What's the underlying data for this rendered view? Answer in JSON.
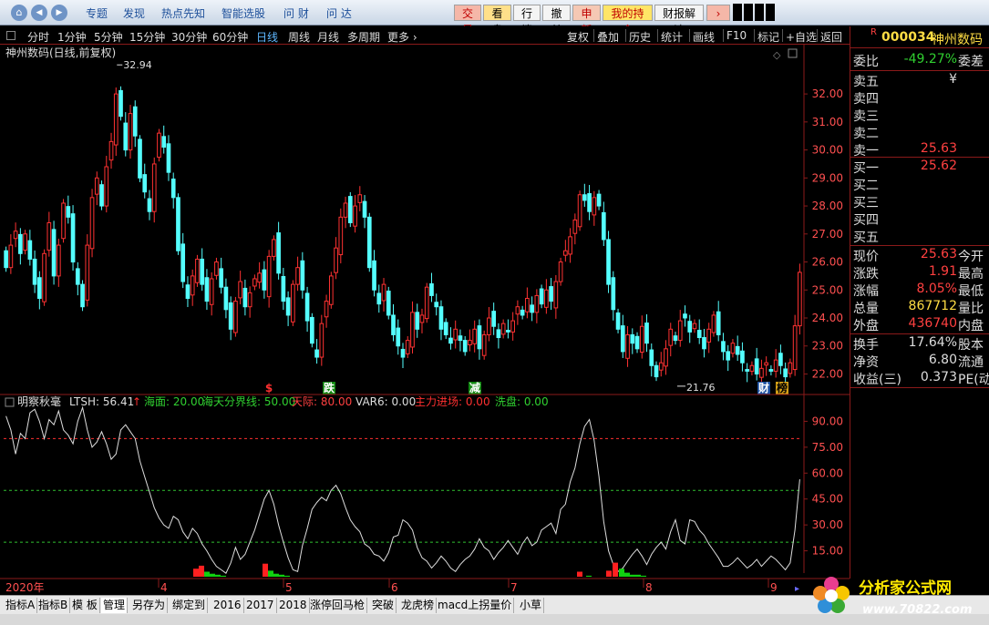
{
  "topbar": {
    "menu": [
      "专题",
      "发现",
      "热点先知",
      "智能选股",
      "问 财",
      "问 达"
    ],
    "quick_tabs": [
      {
        "label": "交易",
        "bg": "#f5b7a8",
        "color": "#c00000"
      },
      {
        "label": "看盘",
        "bg": "#ffe08a",
        "color": "#000000"
      },
      {
        "label": "行情",
        "bg": "#f4f4f4",
        "color": "#000000"
      },
      {
        "label": "撤单",
        "bg": "#f4f4f4",
        "color": "#000000"
      },
      {
        "label": "申新",
        "bg": "#f5c8b4",
        "color": "#c00000"
      },
      {
        "label": "我的持仓",
        "bg": "#ffe566",
        "color": "#c00000"
      },
      {
        "label": "财报解读",
        "bg": "#f4f4f4",
        "color": "#000000"
      }
    ],
    "more_arrow": "›"
  },
  "period_bar": {
    "periods": [
      "分时",
      "1分钟",
      "5分钟",
      "15分钟",
      "30分钟",
      "60分钟",
      "日线",
      "周线",
      "月线",
      "多周期",
      "更多 ›"
    ],
    "selected": "日线",
    "tools": [
      "复权",
      "叠加",
      "历史",
      "统计",
      "画线",
      "F10",
      "标记",
      "+自选",
      "返回"
    ]
  },
  "main_chart": {
    "title": "神州数码(日线,前复权)",
    "high_label": "32.94",
    "low_label": "21.76",
    "price_ticks": [
      "32.00",
      "31.00",
      "30.00",
      "29.00",
      "28.00",
      "27.00",
      "26.00",
      "25.00",
      "24.00",
      "23.00",
      "22.00"
    ],
    "markers": [
      {
        "text": "$",
        "color": "#ff3030"
      },
      {
        "text": "跌",
        "color": "#ffffff",
        "bg": "#118811"
      },
      {
        "text": "减",
        "color": "#ffffff",
        "bg": "#118811"
      },
      {
        "text": "财",
        "color": "#ffffff",
        "bg": "#1a4fa0"
      },
      {
        "text": "榜",
        "color": "#000000",
        "bg": "#d4a017"
      }
    ]
  },
  "chart_data": {
    "type": "candlestick",
    "y_range": [
      21.3,
      33.5
    ],
    "high": 32.94,
    "low": 21.76,
    "close_last": 25.63,
    "up_color": "#ff3232",
    "down_color": "#54ffff",
    "x_axis_labels": [
      "2020年",
      "4",
      "5",
      "6",
      "7",
      "8",
      "9"
    ]
  },
  "indicator": {
    "name": "明察秋毫",
    "items": [
      {
        "text": "LTSH: 56.41",
        "color": "#dddddd"
      },
      {
        "text": "↑",
        "color": "#ff3030"
      },
      {
        "text": "海面: 20.00",
        "color": "#30d030"
      },
      {
        "text": "海天分界线: 50.00",
        "color": "#30d030"
      },
      {
        "text": "天际: 80.00",
        "color": "#ff4040"
      },
      {
        "text": "VAR6: 0.00",
        "color": "#dddddd"
      },
      {
        "text": "主力进场: 0.00",
        "color": "#ff3030"
      },
      {
        "text": "洗盘: 0.00",
        "color": "#30d030"
      }
    ],
    "ticks": [
      "90.00",
      "75.00",
      "60.00",
      "45.00",
      "30.00",
      "15.00"
    ],
    "y_range": [
      0,
      100
    ],
    "sea_level": 20,
    "horizon": 50,
    "sky": 80
  },
  "quote": {
    "code": "000034",
    "name": "神州数码",
    "ratio": {
      "label": "委比",
      "value": "-49.27%",
      "suffix": "委差",
      "color": "#30d030"
    },
    "sells": [
      {
        "label": "卖五",
        "value": "¥",
        "color": "#dddddd"
      },
      {
        "label": "卖四",
        "value": "",
        "color": "#dddddd"
      },
      {
        "label": "卖三",
        "value": "",
        "color": "#dddddd"
      },
      {
        "label": "卖二",
        "value": "",
        "color": "#dddddd"
      },
      {
        "label": "卖一",
        "value": "25.63",
        "color": "#ff4040"
      }
    ],
    "buys": [
      {
        "label": "买一",
        "value": "25.62",
        "color": "#ff4040"
      },
      {
        "label": "买二",
        "value": "",
        "color": "#dddddd"
      },
      {
        "label": "买三",
        "value": "",
        "color": "#dddddd"
      },
      {
        "label": "买四",
        "value": "",
        "color": "#dddddd"
      },
      {
        "label": "买五",
        "value": "",
        "color": "#dddddd"
      }
    ],
    "stats": [
      {
        "label": "现价",
        "value": "25.63",
        "suffix": "今开",
        "color": "#ff4040"
      },
      {
        "label": "涨跌",
        "value": "1.91",
        "suffix": "最高",
        "color": "#ff4040"
      },
      {
        "label": "涨幅",
        "value": "8.05%",
        "suffix": "最低",
        "color": "#ff4040"
      },
      {
        "label": "总量",
        "value": "867712",
        "suffix": "量比",
        "color": "#ffdd44"
      },
      {
        "label": "外盘",
        "value": "436740",
        "suffix": "内盘",
        "color": "#ff4040"
      }
    ],
    "fundamentals": [
      {
        "label": "换手",
        "value": "17.64%",
        "suffix": "股本",
        "color": "#dddddd"
      },
      {
        "label": "净资",
        "value": "6.80",
        "suffix": "流通",
        "color": "#dddddd"
      },
      {
        "label": "收益(三)",
        "value": "0.373",
        "suffix": "PE(动",
        "color": "#dddddd"
      }
    ]
  },
  "bottom_tabs": [
    "指标A",
    "指标B",
    "模 板",
    "管理",
    "另存为",
    "绑定到",
    "2016",
    "2017",
    "2018",
    "涨停回马枪",
    "突破",
    "龙虎榜",
    "macd上拐量价",
    "小草"
  ],
  "active_bottom_tab": "管理",
  "logo": {
    "main": "分析家公式网",
    "url": "www.70822.com"
  }
}
